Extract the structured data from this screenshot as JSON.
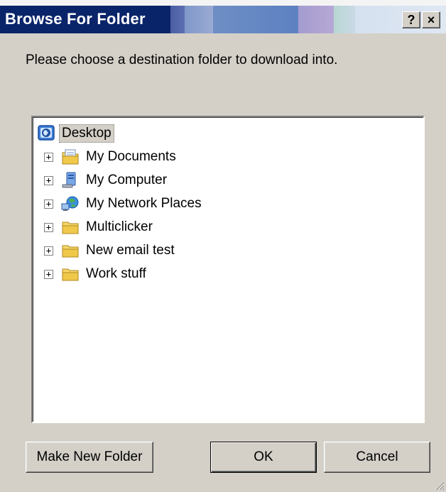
{
  "window": {
    "title": "Browse For Folder",
    "help_glyph": "?",
    "close_glyph": "×"
  },
  "instruction": "Please choose a destination folder to download into.",
  "tree": {
    "root": {
      "label": "Desktop",
      "icon": "desktop-icon",
      "selected": true
    },
    "items": [
      {
        "label": "My Documents",
        "icon": "my-documents-icon",
        "expander": "+"
      },
      {
        "label": "My Computer",
        "icon": "my-computer-icon",
        "expander": "+"
      },
      {
        "label": "My Network Places",
        "icon": "network-places-icon",
        "expander": "+"
      },
      {
        "label": "Multiclicker",
        "icon": "folder-icon",
        "expander": "+"
      },
      {
        "label": "New email test",
        "icon": "folder-icon",
        "expander": "+"
      },
      {
        "label": "Work stuff",
        "icon": "folder-icon",
        "expander": "+"
      }
    ]
  },
  "buttons": {
    "make_new_folder": "Make New Folder",
    "ok": "OK",
    "cancel": "Cancel"
  },
  "colors": {
    "title_bar": "#0a246a",
    "dialog_face": "#d4d0c8",
    "tree_background": "#ffffff"
  }
}
